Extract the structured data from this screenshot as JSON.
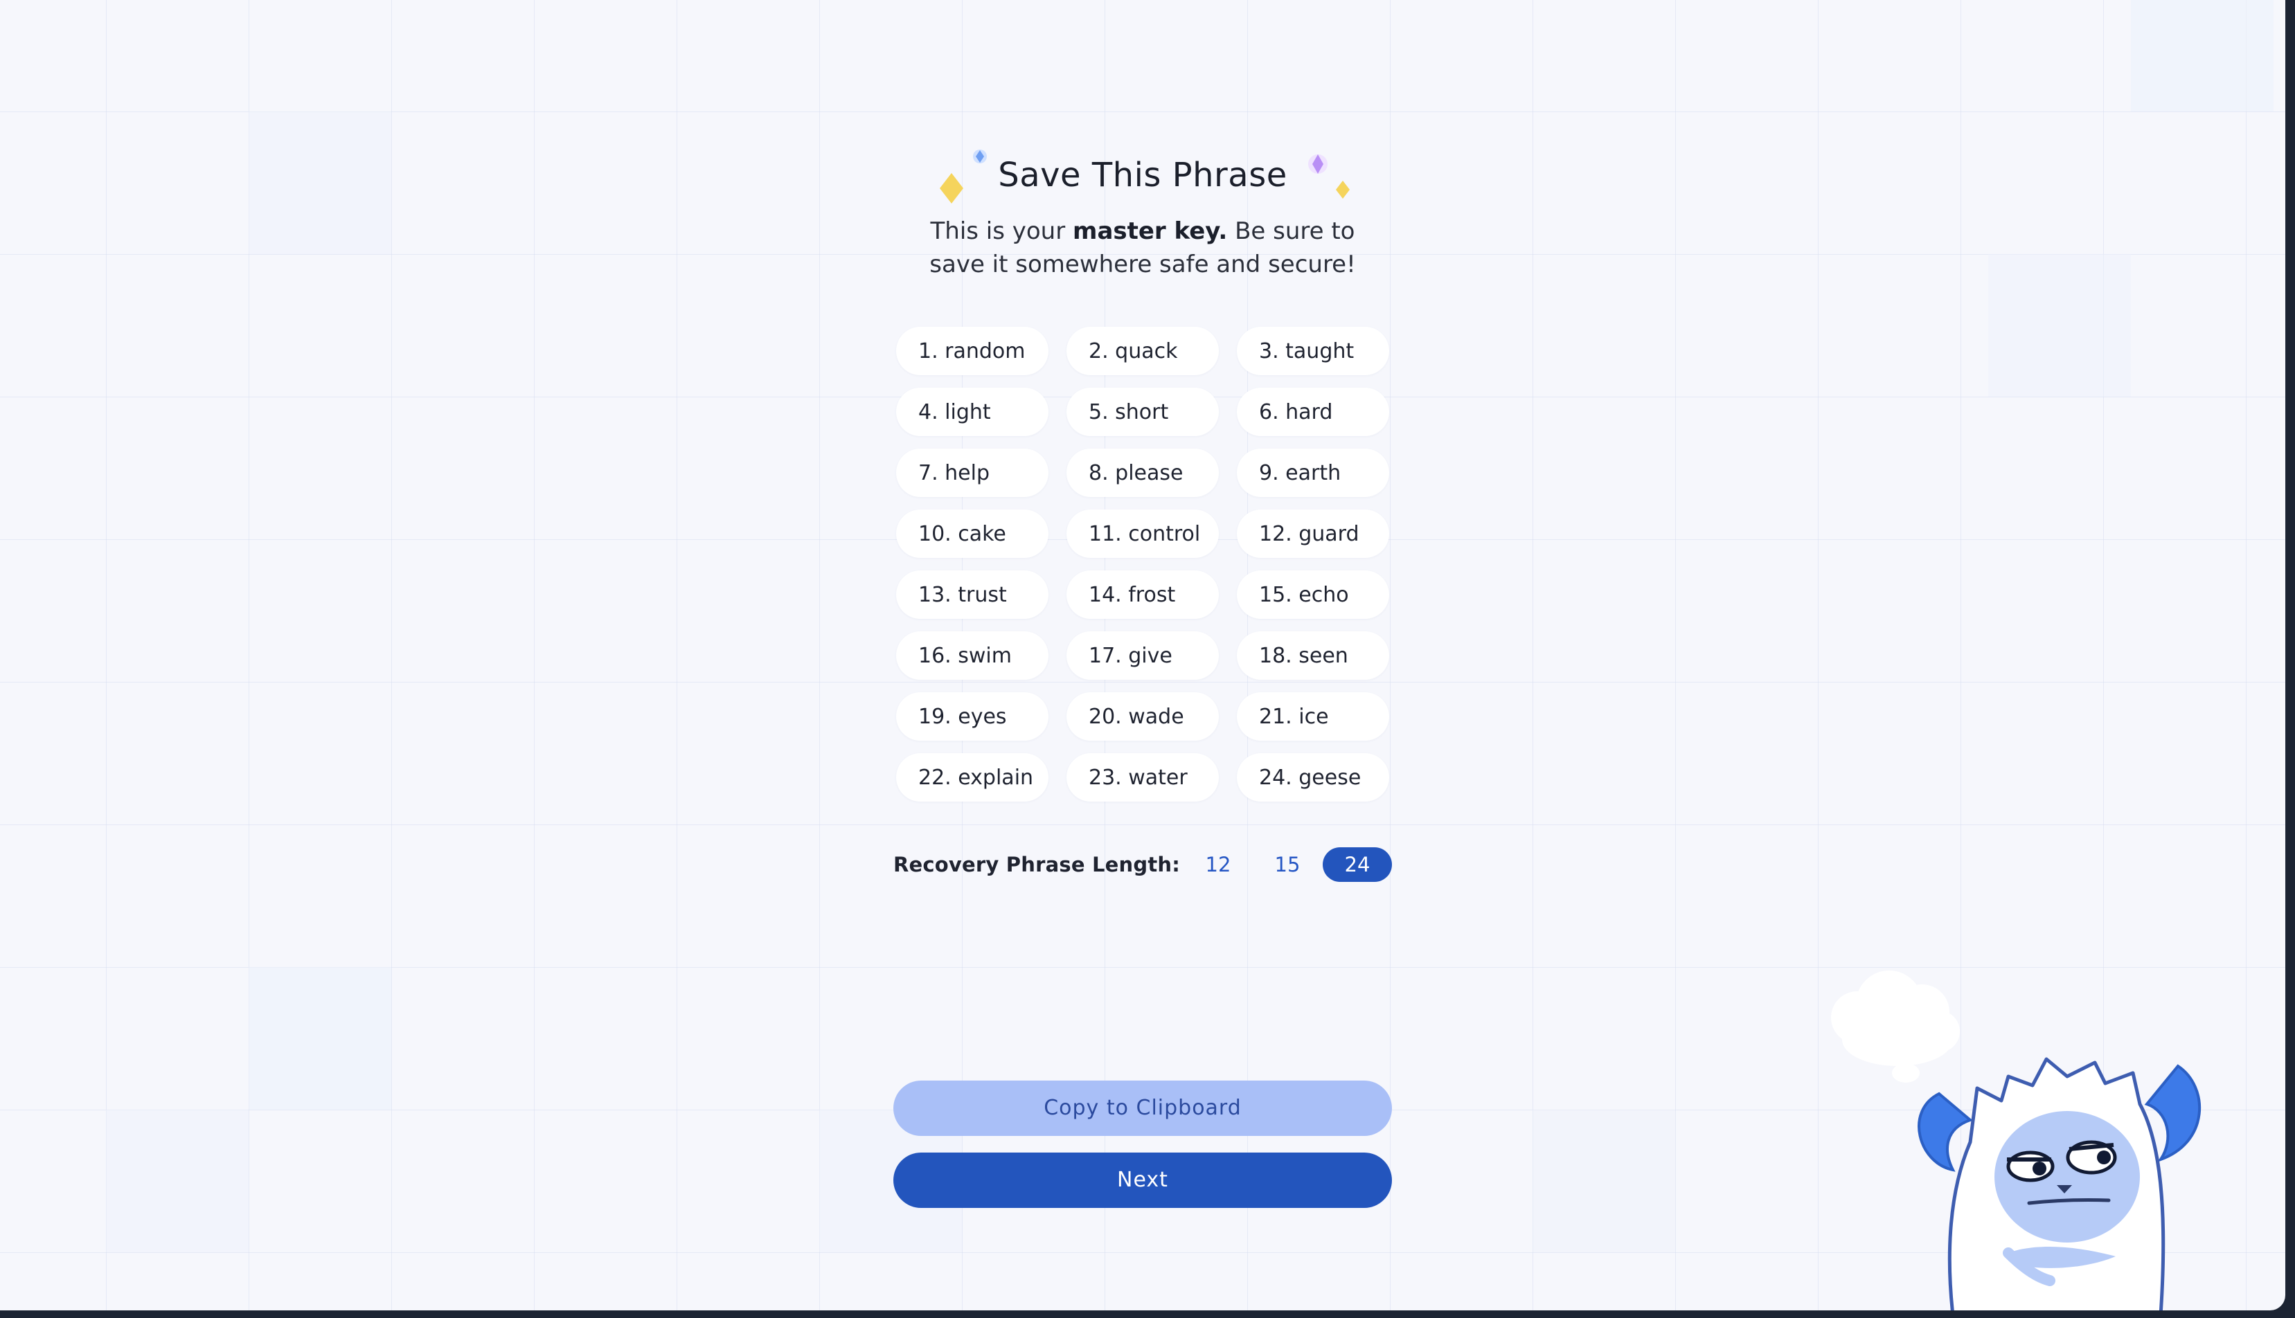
{
  "header": {
    "title": "Save This Phrase",
    "subtitle_line1_pre": "This is your ",
    "subtitle_line1_bold": "master key.",
    "subtitle_line1_post": " Be sure to",
    "subtitle_line2": "save it somewhere safe and secure!"
  },
  "recovery_words": [
    "1. random",
    "2. quack",
    "3. taught",
    "4. light",
    "5. short",
    "6. hard",
    "7. help",
    "8. please",
    "9. earth",
    "10. cake",
    "11. control",
    "12. guard",
    "13. trust",
    "14. frost",
    "15. echo",
    "16. swim",
    "17. give",
    "18. seen",
    "19. eyes",
    "20. wade",
    "21. ice",
    "22. explain",
    "23. water",
    "24. geese"
  ],
  "length_selector": {
    "label": "Recovery Phrase Length:",
    "options": [
      "12",
      "15",
      "24"
    ],
    "selected": "24"
  },
  "buttons": {
    "copy_label": "Copy to Clipboard",
    "next_label": "Next"
  },
  "icons": {
    "sparkles": "sparkle-icon",
    "mascot": "yeti-mascot",
    "thought": "thought-cloud-icon"
  },
  "colors": {
    "primary": "#2355bd",
    "primary_light": "#a9bff7",
    "background": "#f6f7fc",
    "text": "#1b1f2b"
  }
}
